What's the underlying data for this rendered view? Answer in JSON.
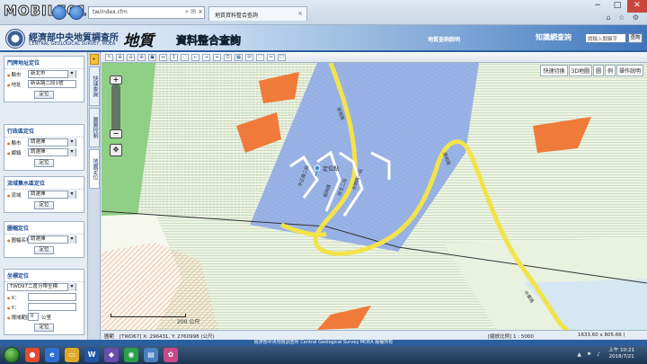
{
  "overlay_logo": "MOBILE01",
  "browser": {
    "address": "tw/index.cfm",
    "address_icons": "⌕ ✉ ×",
    "tab_title": "地質資料整合查詢",
    "window_controls": [
      "−",
      "□",
      "✕"
    ],
    "toolbar_icons": "⌂ ☆ ⚙"
  },
  "header": {
    "agency": "經濟部中央地質調查所",
    "agency_en": "CENTRAL GEOLOGICAL SURVEY, MOEA",
    "brand_calligraphy": "地質",
    "brand_title": "資料整合查詢",
    "link_help": "地質查詢說明",
    "knowledge_label": "知識網查詢",
    "knowledge_placeholder": "請輸入關鍵字",
    "knowledge_go": "查詢"
  },
  "left_panel": {
    "doorplate": {
      "title": "門牌地址定位",
      "city_label": "縣市",
      "city_value": "新北市",
      "address_label": "地址",
      "address_value": "新店路二段1號",
      "button": "定位"
    },
    "admin": {
      "title": "行政區定位",
      "city_label": "縣市",
      "city_value": "請選擇",
      "town_label": "鄉鎮",
      "town_value": "請選擇",
      "button": "定位"
    },
    "basin": {
      "title": "流域集水區定位",
      "label": "流域",
      "value": "請選擇",
      "button": "定位"
    },
    "sheet": {
      "title": "圖幅定位",
      "label": "圖幅名稱",
      "value": "請選擇",
      "button": "定位"
    },
    "coord": {
      "title": "坐標定位",
      "datum_value": "TWD97二度分帶坐標",
      "x_label": "X：",
      "y_label": "Y：",
      "radius_label": "環域範圍",
      "radius_value": "0",
      "radius_unit": "公里",
      "button": "定位"
    }
  },
  "side_tabs": [
    "快速查詢",
    "圖層控制",
    "地圖定位"
  ],
  "toolbar_tools": [
    "↖",
    "⊕",
    "⊖",
    "⊗",
    "▣",
    "↔",
    "↕",
    "◌",
    "←",
    "→",
    "⌖",
    "☰",
    "▦",
    "✉",
    "⛶",
    "✂",
    "☐"
  ],
  "map": {
    "right_controls": [
      "快速切換",
      "3D地圖",
      "圖",
      "例",
      "操作說明"
    ],
    "marker_label": "定位點",
    "road_labels": [
      "張南路",
      "連裕路",
      "中正路二段",
      "城與路",
      "民生二段",
      "光明路一段",
      "中華路"
    ],
    "scale_label": "200 公尺",
    "colors": {
      "blue_zone": "#9ab3e6",
      "green_zone": "#8fcf86",
      "orange_zone": "#f07a3a",
      "road": "#f2e34c",
      "background": "#e8eedd"
    }
  },
  "status_bar": {
    "mode": "圖範",
    "coord": "[TWD67] X: 296431, Y: 2760998 (公尺)",
    "scale": "[縮放比例] 1 : 5000",
    "size": "1633.60 x 805.66 ("
  },
  "footer": "經濟部中央地質調查所 Central Geological Survey MOEA 版權所有",
  "taskbar": {
    "tray": "▲ ⚑ ♪",
    "time": "上午 10:21",
    "date": "2018/7/21"
  }
}
